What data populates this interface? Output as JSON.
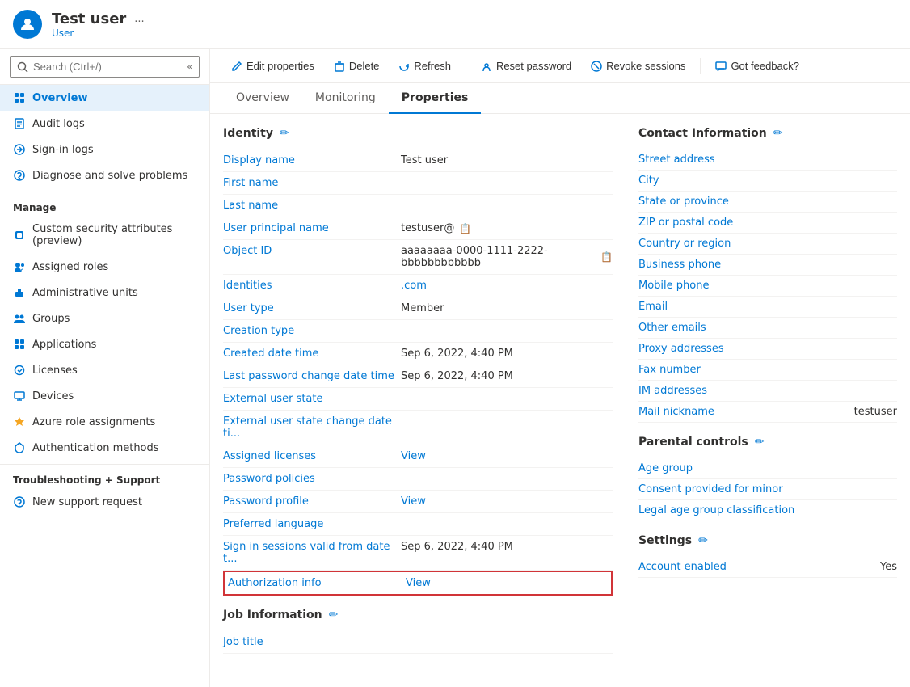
{
  "header": {
    "user_name": "Test user",
    "user_type": "User",
    "more_label": "..."
  },
  "toolbar": {
    "edit_properties": "Edit properties",
    "delete": "Delete",
    "refresh": "Refresh",
    "reset_password": "Reset password",
    "revoke_sessions": "Revoke sessions",
    "got_feedback": "Got feedback?"
  },
  "tabs": [
    {
      "label": "Overview",
      "active": false
    },
    {
      "label": "Monitoring",
      "active": false
    },
    {
      "label": "Properties",
      "active": true
    }
  ],
  "sidebar": {
    "search_placeholder": "Search (Ctrl+/)",
    "nav_items": [
      {
        "id": "overview",
        "label": "Overview",
        "active": true
      },
      {
        "id": "audit-logs",
        "label": "Audit logs",
        "active": false
      },
      {
        "id": "sign-in-logs",
        "label": "Sign-in logs",
        "active": false
      },
      {
        "id": "diagnose",
        "label": "Diagnose and solve problems",
        "active": false
      }
    ],
    "manage_label": "Manage",
    "manage_items": [
      {
        "id": "custom-security",
        "label": "Custom security attributes (preview)",
        "active": false
      },
      {
        "id": "assigned-roles",
        "label": "Assigned roles",
        "active": false
      },
      {
        "id": "admin-units",
        "label": "Administrative units",
        "active": false
      },
      {
        "id": "groups",
        "label": "Groups",
        "active": false
      },
      {
        "id": "applications",
        "label": "Applications",
        "active": false
      },
      {
        "id": "licenses",
        "label": "Licenses",
        "active": false
      },
      {
        "id": "devices",
        "label": "Devices",
        "active": false
      },
      {
        "id": "azure-roles",
        "label": "Azure role assignments",
        "active": false
      },
      {
        "id": "auth-methods",
        "label": "Authentication methods",
        "active": false
      }
    ],
    "support_label": "Troubleshooting + Support",
    "support_items": [
      {
        "id": "new-support",
        "label": "New support request",
        "active": false
      }
    ]
  },
  "identity_section": {
    "title": "Identity",
    "fields": [
      {
        "label": "Display name",
        "value": "Test user",
        "type": "text"
      },
      {
        "label": "First name",
        "value": "",
        "type": "text"
      },
      {
        "label": "Last name",
        "value": "",
        "type": "text"
      },
      {
        "label": "User principal name",
        "value": "testuser@",
        "type": "copy"
      },
      {
        "label": "Object ID",
        "value": "aaaaaaaa-0000-1111-2222-bbbbbbbbbbbb",
        "type": "copy"
      },
      {
        "label": "Identities",
        "value": ".com",
        "type": "link"
      },
      {
        "label": "User type",
        "value": "Member",
        "type": "text"
      },
      {
        "label": "Creation type",
        "value": "",
        "type": "text"
      },
      {
        "label": "Created date time",
        "value": "Sep 6, 2022, 4:40 PM",
        "type": "text"
      },
      {
        "label": "Last password change date time",
        "value": "Sep 6, 2022, 4:40 PM",
        "type": "text"
      },
      {
        "label": "External user state",
        "value": "",
        "type": "text"
      },
      {
        "label": "External user state change date ti...",
        "value": "",
        "type": "text"
      },
      {
        "label": "Assigned licenses",
        "value": "View",
        "type": "link"
      },
      {
        "label": "Password policies",
        "value": "",
        "type": "text"
      },
      {
        "label": "Password profile",
        "value": "View",
        "type": "link"
      },
      {
        "label": "Preferred language",
        "value": "",
        "type": "text"
      },
      {
        "label": "Sign in sessions valid from date t...",
        "value": "Sep 6, 2022, 4:40 PM",
        "type": "text"
      },
      {
        "label": "Authorization info",
        "value": "View",
        "type": "auth-link",
        "highlighted": true
      }
    ]
  },
  "job_section": {
    "title": "Job Information",
    "fields": [
      {
        "label": "Job title",
        "value": "",
        "type": "text"
      }
    ]
  },
  "contact_section": {
    "title": "Contact Information",
    "fields": [
      {
        "label": "Street address",
        "value": ""
      },
      {
        "label": "City",
        "value": ""
      },
      {
        "label": "State or province",
        "value": ""
      },
      {
        "label": "ZIP or postal code",
        "value": ""
      },
      {
        "label": "Country or region",
        "value": ""
      },
      {
        "label": "Business phone",
        "value": ""
      },
      {
        "label": "Mobile phone",
        "value": ""
      },
      {
        "label": "Email",
        "value": ""
      },
      {
        "label": "Other emails",
        "value": ""
      },
      {
        "label": "Proxy addresses",
        "value": ""
      },
      {
        "label": "Fax number",
        "value": ""
      },
      {
        "label": "IM addresses",
        "value": ""
      },
      {
        "label": "Mail nickname",
        "value": "testuser"
      }
    ]
  },
  "parental_section": {
    "title": "Parental controls",
    "fields": [
      {
        "label": "Age group",
        "value": ""
      },
      {
        "label": "Consent provided for minor",
        "value": ""
      },
      {
        "label": "Legal age group classification",
        "value": ""
      }
    ]
  },
  "settings_section": {
    "title": "Settings",
    "fields": [
      {
        "label": "Account enabled",
        "value": "Yes"
      }
    ]
  }
}
